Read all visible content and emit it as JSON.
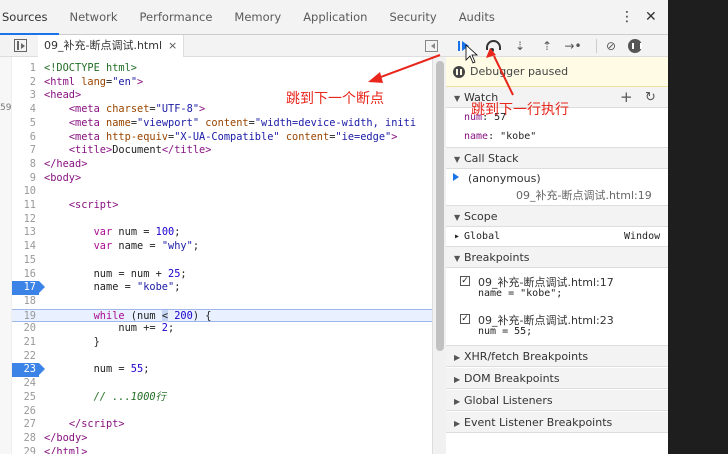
{
  "tabs": [
    "Sources",
    "Network",
    "Performance",
    "Memory",
    "Application",
    "Security",
    "Audits"
  ],
  "window_menu": "⋮",
  "window_close": "✕",
  "file_tab": {
    "name": "09_补充-断点调试.html",
    "close": "×"
  },
  "gutter_fragment": "59",
  "code_lines": [
    {
      "n": "1",
      "html": "<span class='c-comment'>&lt;!DOCTYPE html&gt;</span>"
    },
    {
      "n": "2",
      "html": "<span class='c-tag'>&lt;html</span> <span class='c-attr'>lang</span>=<span class='c-str'>\"en\"</span><span class='c-tag'>&gt;</span>"
    },
    {
      "n": "3",
      "html": "<span class='c-tag'>&lt;head&gt;</span>"
    },
    {
      "n": "4",
      "html": "    <span class='c-tag'>&lt;meta</span> <span class='c-attr'>charset</span>=<span class='c-str'>\"UTF-8\"</span><span class='c-tag'>&gt;</span>"
    },
    {
      "n": "5",
      "html": "    <span class='c-tag'>&lt;meta</span> <span class='c-attr'>name</span>=<span class='c-str'>\"viewport\"</span> <span class='c-attr'>content</span>=<span class='c-str'>\"width=device-width, initi</span>"
    },
    {
      "n": "6",
      "html": "    <span class='c-tag'>&lt;meta</span> <span class='c-attr'>http-equiv</span>=<span class='c-str'>\"X-UA-Compatible\"</span> <span class='c-attr'>content</span>=<span class='c-str'>\"ie=edge\"</span><span class='c-tag'>&gt;</span>"
    },
    {
      "n": "7",
      "html": "    <span class='c-tag'>&lt;title&gt;</span>Document<span class='c-tag'>&lt;/title&gt;</span>"
    },
    {
      "n": "8",
      "html": "<span class='c-tag'>&lt;/head&gt;</span>"
    },
    {
      "n": "9",
      "html": "<span class='c-tag'>&lt;body&gt;</span>"
    },
    {
      "n": "10",
      "html": ""
    },
    {
      "n": "11",
      "html": "    <span class='c-tag'>&lt;script&gt;</span>"
    },
    {
      "n": "12",
      "html": ""
    },
    {
      "n": "13",
      "html": "        <span class='c-kw'>var</span> num = <span class='c-num'>100</span>;"
    },
    {
      "n": "14",
      "html": "        <span class='c-kw'>var</span> name = <span class='c-str'>\"why\"</span>;"
    },
    {
      "n": "15",
      "html": ""
    },
    {
      "n": "16",
      "html": "        num = num + <span class='c-num'>25</span>;"
    },
    {
      "n": "17",
      "html": "        name = <span class='c-str'>\"kobe\"</span>;",
      "bp": true
    },
    {
      "n": "18",
      "html": ""
    },
    {
      "n": "19",
      "html": "        <span class='c-kw'>while</span> (num <span class='c-cursor'>&lt;</span> <span class='c-num'>200</span>) {",
      "hl": true
    },
    {
      "n": "20",
      "html": "            num += <span class='c-num'>2</span>;"
    },
    {
      "n": "21",
      "html": "        }"
    },
    {
      "n": "22",
      "html": ""
    },
    {
      "n": "23",
      "html": "        num = <span class='c-num'>55</span>;",
      "bp": true
    },
    {
      "n": "24",
      "html": ""
    },
    {
      "n": "25",
      "html": "        <span class='c-comment'><i>// ...1000行</i></span>"
    },
    {
      "n": "26",
      "html": ""
    },
    {
      "n": "27",
      "html": "    <span class='c-tag'>&lt;/script&gt;</span>"
    },
    {
      "n": "28",
      "html": "<span class='c-tag'>&lt;/body&gt;</span>"
    },
    {
      "n": "29",
      "html": "<span class='c-tag'>&lt;/html&gt;</span>"
    }
  ],
  "debug_toolbar": {
    "step_into": "⇣",
    "step_out": "⇡",
    "step": "→•",
    "deactivate": "⊘"
  },
  "paused_text": "Debugger paused",
  "annotations": {
    "next_breakpoint": "跳到下一个断点",
    "next_line": "跳到下一行执行"
  },
  "watch": {
    "title": "Watch",
    "add": "+",
    "refresh": "↻",
    "rows": [
      {
        "k": "num",
        "v": ": 57"
      },
      {
        "k": "name",
        "v": ": \"kobe\""
      }
    ]
  },
  "call_stack": {
    "title": "Call Stack",
    "frame": "(anonymous)",
    "location": "09_补充-断点调试.html:19"
  },
  "scope": {
    "title": "Scope",
    "global_label": "Global",
    "global_value": "Window"
  },
  "breakpoints": {
    "title": "Breakpoints",
    "items": [
      {
        "file": "09_补充-断点调试.html:17",
        "code": "name = \"kobe\";",
        "checked": "✓"
      },
      {
        "file": "09_补充-断点调试.html:23",
        "code": "num = 55;",
        "checked": "✓"
      }
    ]
  },
  "collapsed_sections": [
    "XHR/fetch Breakpoints",
    "DOM Breakpoints",
    "Global Listeners",
    "Event Listener Breakpoints"
  ],
  "colors": {
    "accent": "#1a73e8",
    "annotation_red": "#e8261c",
    "breakpoint_blue": "#3c83e8"
  }
}
